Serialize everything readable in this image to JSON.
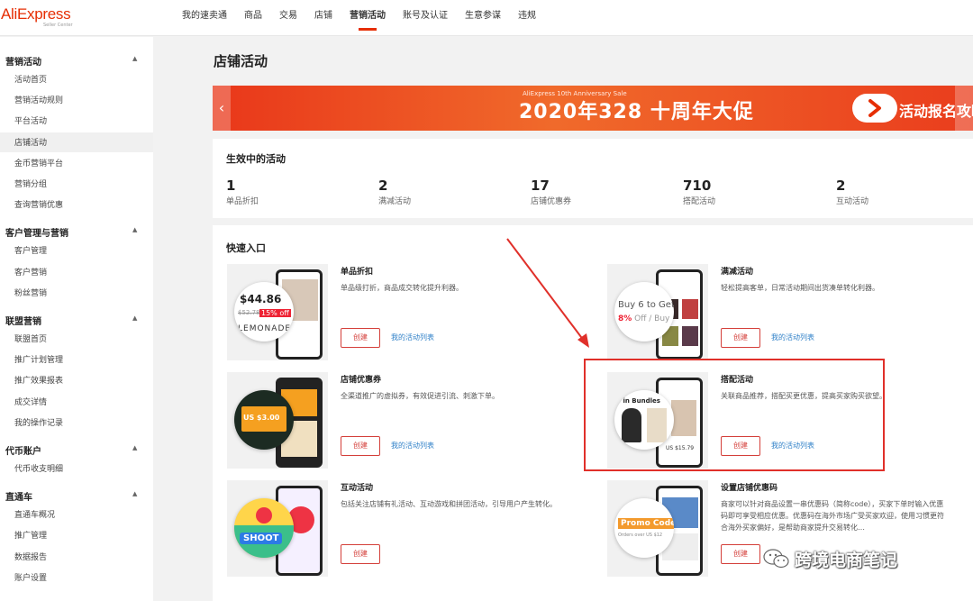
{
  "logo": {
    "brand": "AliExpress",
    "sub": "Seller Center"
  },
  "nav": {
    "items": [
      "我的速卖通",
      "商品",
      "交易",
      "店铺",
      "营销活动",
      "账号及认证",
      "生意参谋",
      "违规"
    ],
    "active_index": 4
  },
  "sidebar": {
    "sections": [
      {
        "title": "营销活动",
        "items": [
          "活动首页",
          "营销活动规则",
          "平台活动",
          "店铺活动",
          "金币营销平台",
          "营销分组",
          "查询营销优惠"
        ]
      },
      {
        "title": "客户管理与营销",
        "items": [
          "客户管理",
          "客户营销",
          "粉丝营销"
        ]
      },
      {
        "title": "联盟营销",
        "items": [
          "联盟首页",
          "推广计划管理",
          "推广效果报表",
          "成交详情",
          "我的操作记录"
        ]
      },
      {
        "title": "代币账户",
        "items": [
          "代币收支明细"
        ]
      },
      {
        "title": "直通车",
        "items": [
          "直通车概况",
          "推广管理",
          "数据报告",
          "账户设置"
        ]
      }
    ],
    "active_item": "店铺活动"
  },
  "page": {
    "title": "店铺活动"
  },
  "banner": {
    "sub": "AliExpress 10th Anniversary Sale",
    "headline": "2020年328 十周年大促",
    "guide": "活动报名攻略",
    "accent": "#ea3d1d"
  },
  "stats": {
    "title": "生效中的活动",
    "items": [
      {
        "value": "1",
        "label": "单品折扣"
      },
      {
        "value": "2",
        "label": "满减活动"
      },
      {
        "value": "17",
        "label": "店铺优惠券"
      },
      {
        "value": "710",
        "label": "搭配活动"
      },
      {
        "value": "2",
        "label": "互动活动"
      }
    ]
  },
  "quick": {
    "title": "快速入口",
    "create_label": "创建",
    "cards": [
      {
        "name": "单品折扣",
        "desc": "单品级打折，商品成交转化提升利器。",
        "link": "我的活动列表",
        "thumb": {
          "price": "$44.86",
          "old": "$52.78",
          "badge": "15% off",
          "word": "LEMONADE"
        }
      },
      {
        "name": "满减活动",
        "desc": "轻松提高客单，日常活动期间出货凑单转化利器。",
        "link": "我的活动列表",
        "thumb": {
          "line1": "Buy 6 to Get",
          "pct": "8%",
          "line2": " Off / Buy"
        }
      },
      {
        "name": "店铺优惠券",
        "desc": "全渠道推广的虚拟券，有效促进引流、刺激下单。",
        "link": "我的活动列表",
        "thumb": {
          "coupon": "US $3.00"
        }
      },
      {
        "name": "搭配活动",
        "desc": "关联商品推荐，搭配买更优惠，提高买家购买欲望。",
        "link": "我的活动列表",
        "thumb": {
          "line1": "p in Bundles",
          "price": "US $15.79"
        }
      },
      {
        "name": "互动活动",
        "desc": "包括关注店铺有礼活动、互动游戏和拼团活动，引导用户产生转化。",
        "link": "",
        "thumb": {
          "word": "SHOOT"
        }
      },
      {
        "name": "设置店铺优惠码",
        "desc": "商家可以针对商品设置一串优惠码（简称code），买家下单时输入优惠码即可享受相应优惠。优惠码在海外市场广受买家欢迎，使用习惯更符合海外买家偏好，是帮助商家提升交易转化…",
        "link": "",
        "thumb": {
          "word": "Promo Code",
          "sub": "Orders over US $12"
        }
      }
    ]
  },
  "watermark": "跨境电商笔记",
  "colors": {
    "accent_red": "#e62e04",
    "link_blue": "#2f80c8",
    "button_red": "#d43f3a"
  }
}
